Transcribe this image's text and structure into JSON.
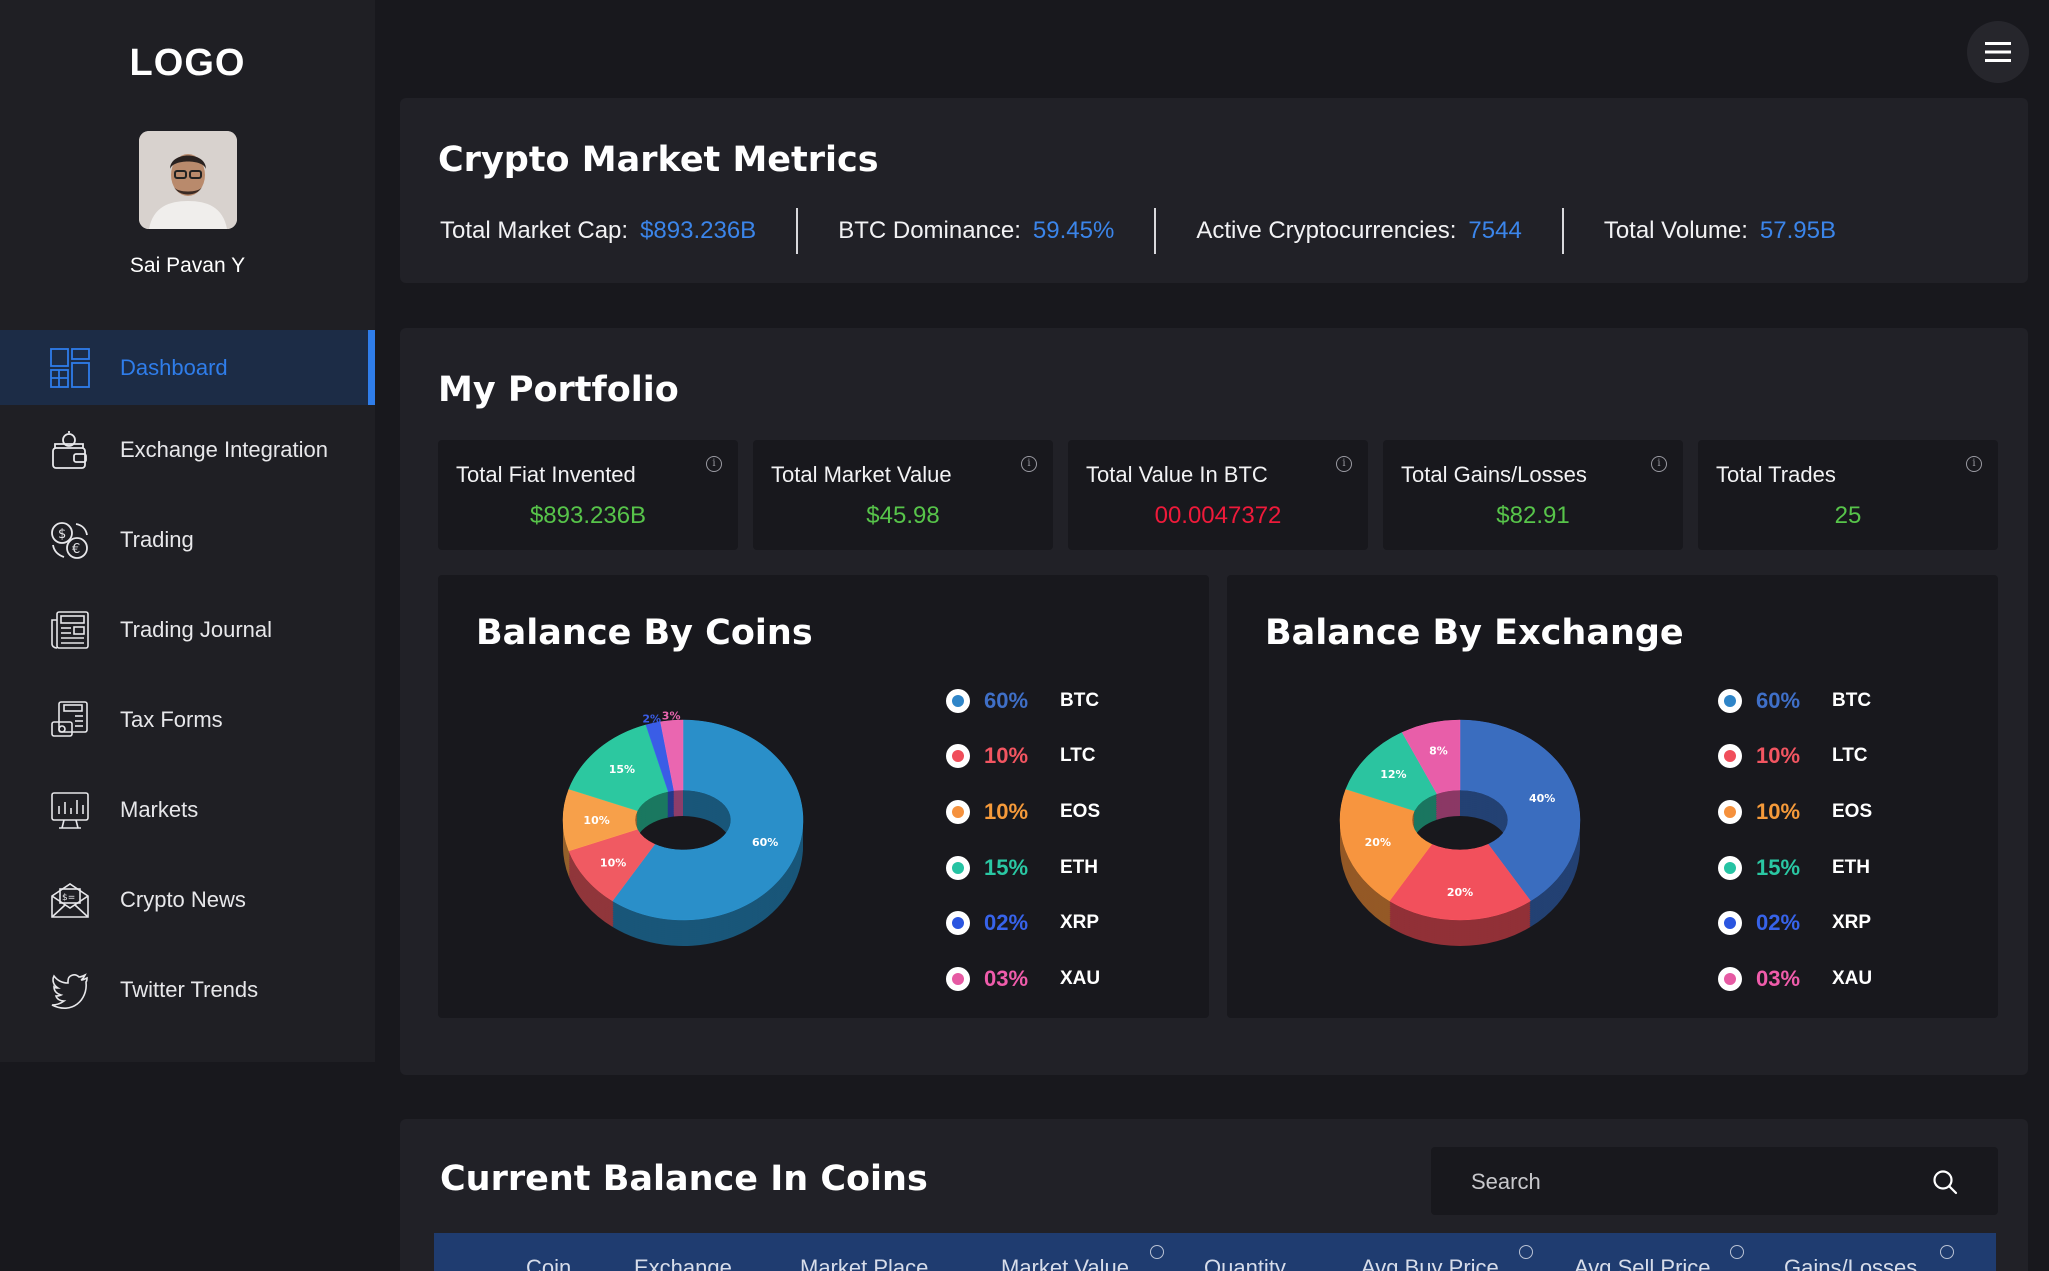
{
  "sidebar": {
    "logo": "LOGO",
    "user_name": "Sai Pavan Y",
    "items": [
      {
        "label": "Dashboard",
        "icon": "dashboard-icon",
        "active": true
      },
      {
        "label": "Exchange Integration",
        "icon": "wallet-icon",
        "active": false
      },
      {
        "label": "Trading",
        "icon": "currency-exchange-icon",
        "active": false
      },
      {
        "label": "Trading Journal",
        "icon": "newspaper-icon",
        "active": false
      },
      {
        "label": "Tax Forms",
        "icon": "tax-form-icon",
        "active": false
      },
      {
        "label": "Markets",
        "icon": "market-chart-icon",
        "active": false
      },
      {
        "label": "Crypto News",
        "icon": "mail-news-icon",
        "active": false
      },
      {
        "label": "Twitter Trends",
        "icon": "twitter-icon",
        "active": false
      }
    ]
  },
  "header": {
    "menu_icon": "hamburger-menu-icon"
  },
  "metrics": {
    "title": "Crypto Market Metrics",
    "items": [
      {
        "label": "Total Market Cap:",
        "value": "$893.236B"
      },
      {
        "label": "BTC Dominance:",
        "value": "59.45%"
      },
      {
        "label": "Active Cryptocurrencies:",
        "value": "7544"
      },
      {
        "label": "Total Volume:",
        "value": "57.95B"
      }
    ]
  },
  "portfolio": {
    "title": "My Portfolio",
    "stats": [
      {
        "label": "Total Fiat Invented",
        "value": "$893.236B",
        "color": "#57c44a"
      },
      {
        "label": "Total Market Value",
        "value": "$45.98",
        "color": "#57c44a"
      },
      {
        "label": "Total Value In BTC",
        "value": "00.0047372",
        "color": "#ee1a3a"
      },
      {
        "label": "Total Gains/Losses",
        "value": "$82.91",
        "color": "#57c44a"
      },
      {
        "label": "Total Trades",
        "value": "25",
        "color": "#57c44a"
      }
    ],
    "charts": [
      {
        "title": "Balance By Coins",
        "legend": [
          {
            "pct": "60%",
            "name": "BTC",
            "color": "#2f85c8",
            "text_color": "#3f6fc7"
          },
          {
            "pct": "10%",
            "name": "LTC",
            "color": "#f04d5a",
            "text_color": "#f25561"
          },
          {
            "pct": "10%",
            "name": "EOS",
            "color": "#f5913d",
            "text_color": "#f59a3a"
          },
          {
            "pct": "15%",
            "name": "ETH",
            "color": "#25c3a3",
            "text_color": "#2ac7a3"
          },
          {
            "pct": "02%",
            "name": "XRP",
            "color": "#2a55e0",
            "text_color": "#3763ea"
          },
          {
            "pct": "03%",
            "name": "XAU",
            "color": "#e65aa3",
            "text_color": "#ef5cab"
          }
        ],
        "slices": [
          {
            "label": "60%",
            "value": 60,
            "color": "#2a8fc9"
          },
          {
            "label": "10%",
            "value": 10,
            "color": "#f05a62"
          },
          {
            "label": "10%",
            "value": 10,
            "color": "#f7a04a"
          },
          {
            "label": "15%",
            "value": 15,
            "color": "#2cc8a0"
          },
          {
            "label": "2%",
            "value": 2,
            "color": "#3a5de6"
          },
          {
            "label": "3%",
            "value": 3,
            "color": "#ea66b0"
          }
        ]
      },
      {
        "title": "Balance By Exchange",
        "legend": [
          {
            "pct": "60%",
            "name": "BTC",
            "color": "#2f85c8",
            "text_color": "#3f6fc7"
          },
          {
            "pct": "10%",
            "name": "LTC",
            "color": "#f04d5a",
            "text_color": "#f25561"
          },
          {
            "pct": "10%",
            "name": "EOS",
            "color": "#f5913d",
            "text_color": "#f59a3a"
          },
          {
            "pct": "15%",
            "name": "ETH",
            "color": "#25c3a3",
            "text_color": "#2ac7a3"
          },
          {
            "pct": "02%",
            "name": "XRP",
            "color": "#2a55e0",
            "text_color": "#3763ea"
          },
          {
            "pct": "03%",
            "name": "XAU",
            "color": "#e65aa3",
            "text_color": "#ef5cab"
          }
        ],
        "slices": [
          {
            "label": "40%",
            "value": 40,
            "color": "#3a6dbf"
          },
          {
            "label": "20%",
            "value": 20,
            "color": "#f2505c"
          },
          {
            "label": "20%",
            "value": 20,
            "color": "#f7953f"
          },
          {
            "label": "12%",
            "value": 12,
            "color": "#2bc4a0"
          },
          {
            "label": "8%",
            "value": 8,
            "color": "#e85ea9"
          }
        ]
      }
    ]
  },
  "balance": {
    "title": "Current Balance In Coins",
    "search_placeholder": "Search",
    "columns": [
      "Coin",
      "Exchange",
      "Market Place",
      "Market Value",
      "Quantity",
      "Avg Buy Price",
      "Avg Sell Price",
      "Gains/Losses"
    ]
  }
}
